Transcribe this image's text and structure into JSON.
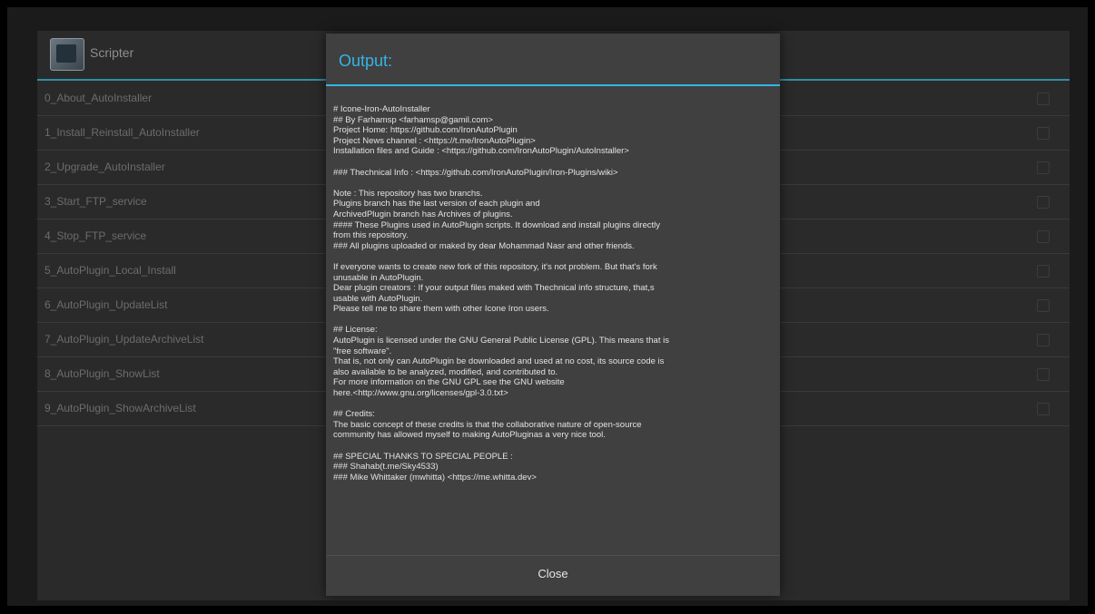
{
  "app": {
    "title": "Scripter",
    "scripts": [
      "0_About_AutoInstaller",
      "1_Install_Reinstall_AutoInstaller",
      "2_Upgrade_AutoInstaller",
      "3_Start_FTP_service",
      "4_Stop_FTP_service",
      "5_AutoPlugin_Local_Install",
      "6_AutoPlugin_UpdateList",
      "7_AutoPlugin_UpdateArchiveList",
      "8_AutoPlugin_ShowList",
      "9_AutoPlugin_ShowArchiveList"
    ]
  },
  "dialog": {
    "title": "Output:",
    "close_label": "Close",
    "output_lines": [
      "# Icone-Iron-AutoInstaller",
      "## By Farhamsp <farhamsp@gamil.com>",
      "Project Home: https://github.com/IronAutoPlugin",
      "Project News channel : <https://t.me/IronAutoPlugin>",
      "Installation files and Guide : <https://github.com/IronAutoPlugin/AutoInstaller>",
      "",
      "### Thechnical Info : <https://github.com/IronAutoPlugin/Iron-Plugins/wiki>",
      "",
      "Note : This repository has two branchs.",
      "Plugins branch has the last version of each plugin and",
      "ArchivedPlugin branch has Archives of plugins.",
      "#### These Plugins used in AutoPlugin scripts. It download and install plugins directly",
      "from this repository.",
      "### All plugins uploaded or maked by dear Mohammad Nasr and other friends.",
      "",
      "If everyone wants to create new fork of this repository, it's not problem. But that's fork",
      "unusable in AutoPlugin.",
      "Dear plugin creators : If your output files maked with Thechnical info structure, that,s",
      "usable with AutoPlugin.",
      "Please tell me to share them with other Icone Iron users.",
      "",
      "## License:",
      "AutoPlugin is licensed under the GNU General Public License (GPL). This means that is",
      "\"free software\".",
      "That is, not only can AutoPlugin be downloaded and used at no cost, its source code is",
      "also available to be analyzed, modified, and contributed to.",
      "For more information on the GNU GPL see the GNU website",
      "here.<http://www.gnu.org/licenses/gpl-3.0.txt>",
      "",
      "## Credits:",
      "The basic concept of these credits is that the collaborative nature of open-source",
      "community has allowed myself to making AutoPluginas a very nice tool.",
      "",
      "## SPECIAL THANKS TO SPECIAL PEOPLE :",
      "### Shahab(t.me/Sky4533)",
      "### Mike Whittaker (mwhitta) <https://me.whitta.dev>"
    ]
  }
}
